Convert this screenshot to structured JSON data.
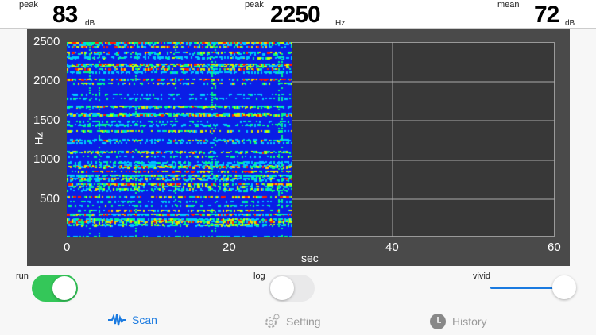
{
  "header": {
    "peak_level": {
      "label": "peak",
      "value": "83",
      "unit": "dB"
    },
    "peak_freq": {
      "label": "peak",
      "value": "2250",
      "unit": "Hz"
    },
    "mean_level": {
      "label": "mean",
      "value": "72",
      "unit": "dB"
    }
  },
  "chart": {
    "y_label": "Hz",
    "x_label": "sec",
    "y_ticks": [
      "2500",
      "2000",
      "1500",
      "1000",
      "500"
    ],
    "x_ticks": [
      "0",
      "20",
      "40",
      "60"
    ],
    "elapsed_sec": 28
  },
  "controls": {
    "run": {
      "label": "run",
      "on": true
    },
    "log": {
      "label": "log",
      "on": false
    },
    "vivid": {
      "label": "vivid",
      "value": 1.0
    }
  },
  "tabs": [
    {
      "label": "Scan",
      "active": true
    },
    {
      "label": "Setting"
    },
    {
      "label": "History"
    }
  ],
  "colors": {
    "accent": "#1a7ae0",
    "switch_on": "#34c759"
  }
}
